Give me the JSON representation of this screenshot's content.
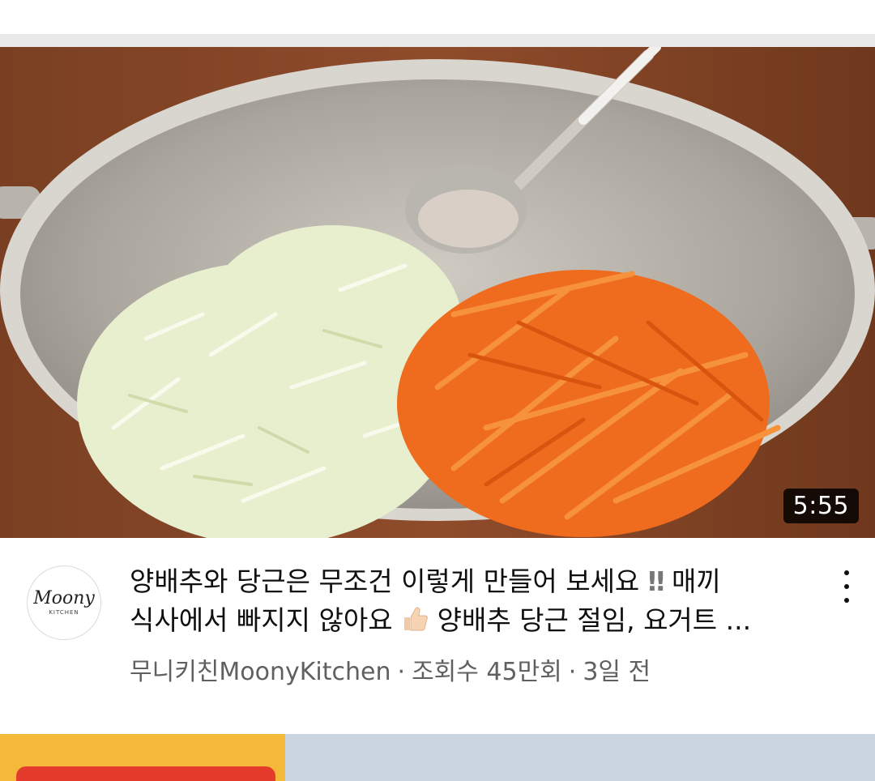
{
  "video": {
    "duration": "5:55",
    "title_line1": "양배추와 당근은 무조건 이렇게 만들어 보세요",
    "title_bangs": "‼",
    "title_line1_end": "매끼",
    "title_line2_start": "식사에서 빠지지 않아요",
    "title_line2_end": "양배추 당근 절임, 요거트 ...",
    "channel": "무니키친MoonyKitchen",
    "views": "조회수 45만회",
    "age": "3일 전",
    "separator": "·"
  },
  "channel_avatar": {
    "logo_top": "Moony",
    "logo_bottom": "KITCHEN"
  },
  "icons": {
    "more": "more-vertical-icon",
    "thumbs_up": "thumbs-up-emoji"
  }
}
